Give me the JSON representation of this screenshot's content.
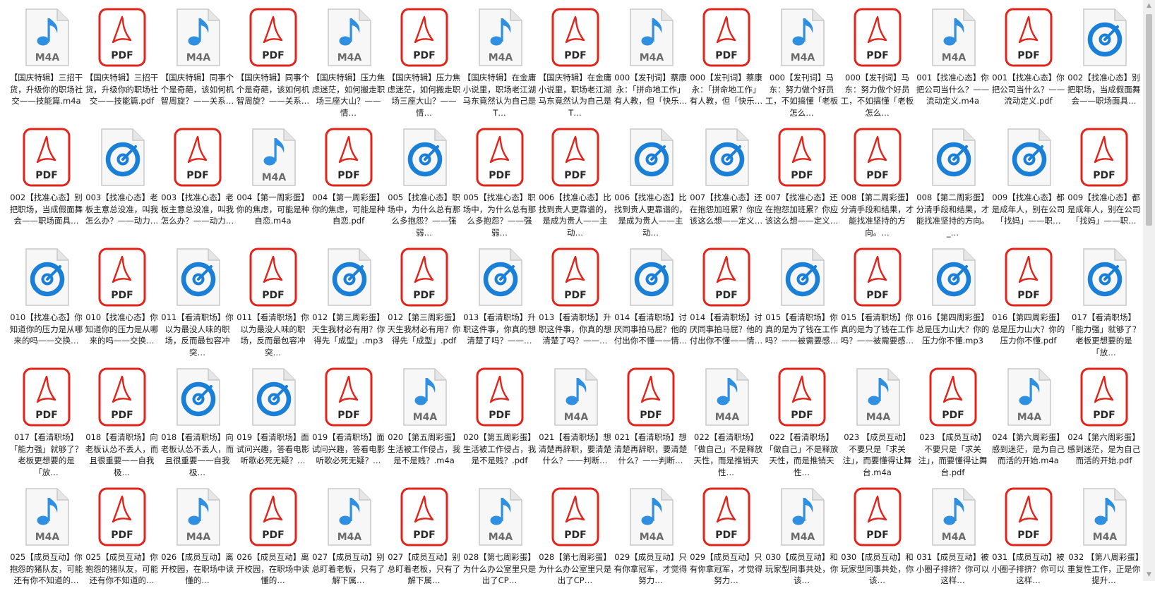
{
  "icon_names": {
    "pdf": "pdf-icon",
    "m4a": "m4a-audio-icon",
    "mp3": "mp3-audio-icon"
  },
  "icon_text": {
    "pdf": "PDF",
    "m4a": "M4A"
  },
  "files": [
    {
      "type": "m4a",
      "name": "【国庆特辑】三招干货，升级你的职场社交——技能篇.m4a"
    },
    {
      "type": "pdf",
      "name": "【国庆特辑】三招干货，升级你的职场社交——技能篇.pdf"
    },
    {
      "type": "m4a",
      "name": "【国庆特辑】同事个个是奇葩，该如何机智周旋？——关系…"
    },
    {
      "type": "pdf",
      "name": "【国庆特辑】同事个个是奇葩，该如何机智周旋？——关系…"
    },
    {
      "type": "m4a",
      "name": "【国庆特辑】压力焦虑迷茫，如何搬走职场三座大山？——情…"
    },
    {
      "type": "pdf",
      "name": "【国庆特辑】压力焦虑迷茫，如何搬走职场三座大山？——情…"
    },
    {
      "type": "m4a",
      "name": "【国庆特辑】在金庸小说里，职场老江湖马东竟然认为自己是T…"
    },
    {
      "type": "pdf",
      "name": "【国庆特辑】在金庸小说里，职场老江湖马东竟然认为自己是T…"
    },
    {
      "type": "m4a",
      "name": "000【发刊词】蔡康永：「拼命地工作」有人教，但「快乐…"
    },
    {
      "type": "pdf",
      "name": "000【发刊词】蔡康永：「拼命地工作」有人教，但「快乐…"
    },
    {
      "type": "m4a",
      "name": "000【发刊词】马东：努力做个好员工，不如搞懂「老板怎么…"
    },
    {
      "type": "pdf",
      "name": "000【发刊词】马东：努力做个好员工，不如搞懂「老板怎么…"
    },
    {
      "type": "m4a",
      "name": "001【找准心态】你把公司当什么？——流动定义.m4a"
    },
    {
      "type": "pdf",
      "name": "001【找准心态】你把公司当什么？——流动定义.pdf"
    },
    {
      "type": "mp3",
      "name": "002【找准心态】别把职场，当成假面舞会——职场面具…"
    },
    {
      "type": "pdf",
      "name": "002【找准心态】别把职场，当成假面舞会——职场面具…"
    },
    {
      "type": "mp3",
      "name": "003【找准心态】老板主意总没准，叫我怎么办？——动力…"
    },
    {
      "type": "pdf",
      "name": "003【找准心态】老板主意总没准，叫我怎么办？——动力…"
    },
    {
      "type": "m4a",
      "name": "004【第一周彩蛋】你的焦虑，可能是种自恋.m4a"
    },
    {
      "type": "pdf",
      "name": "004【第一周彩蛋】你的焦虑，可能是种自恋.pdf"
    },
    {
      "type": "mp3",
      "name": "005【找准心态】职场中，为什么总有那么多抱怨？——强弱…"
    },
    {
      "type": "pdf",
      "name": "005【找准心态】职场中，为什么总有那么多抱怨？——强弱…"
    },
    {
      "type": "pdf",
      "name": "006【找准心态】比找到贵人更靠谱的，是成为贵人——主动…"
    },
    {
      "type": "mp3",
      "name": "006【找准心态】比找到贵人更靠谱的，是成为贵人——主动…"
    },
    {
      "type": "mp3",
      "name": "007【找准心态】还在抱怨加班累？你应该这么想——定义…"
    },
    {
      "type": "pdf",
      "name": "007【找准心态】还在抱怨加班累？你应该这么想——定义…"
    },
    {
      "type": "pdf",
      "name": "008【第二周彩蛋】分清手段和结果，才能找准坚持的方向。…"
    },
    {
      "type": "mp3",
      "name": "008【第二周彩蛋】分清手段和结果，才能找准坚持的方向。_…"
    },
    {
      "type": "mp3",
      "name": "009【找准心态】都是成年人，别在公司「找妈」——职…"
    },
    {
      "type": "pdf",
      "name": "009【找准心态】都是成年人，别在公司「找妈」——职…"
    },
    {
      "type": "mp3",
      "name": "010【找准心态】你知道你的压力是从哪来的吗——交换…"
    },
    {
      "type": "pdf",
      "name": "010【找准心态】你知道你的压力是从哪来的吗——交换…"
    },
    {
      "type": "mp3",
      "name": "011【看清职场】你以为最没人味的职场，反而最包容冲突…"
    },
    {
      "type": "pdf",
      "name": "011【看清职场】你以为最没人味的职场，反而最包容冲突…"
    },
    {
      "type": "mp3",
      "name": "012【第三周彩蛋】天生我材必有用？你得先「成型」.mp3"
    },
    {
      "type": "pdf",
      "name": "012【第三周彩蛋】天生我材必有用？你得先「成型」.pdf"
    },
    {
      "type": "mp3",
      "name": "013【看清职场】升职这件事，你真的想清楚了吗？——…"
    },
    {
      "type": "pdf",
      "name": "013【看清职场】升职这件事，你真的想清楚了吗？——…"
    },
    {
      "type": "mp3",
      "name": "014【看清职场】讨厌同事拍马屁？他的付出你不懂——情…"
    },
    {
      "type": "pdf",
      "name": "014【看清职场】讨厌同事拍马屁？他的付出你不懂——情…"
    },
    {
      "type": "mp3",
      "name": "015【看清职场】你真的是为了钱在工作吗？——被需要感…"
    },
    {
      "type": "pdf",
      "name": "015【看清职场】你真的是为了钱在工作吗？——被需要感…"
    },
    {
      "type": "mp3",
      "name": "016【第四周彩蛋】总是压力山大？你的压力你不懂.mp3"
    },
    {
      "type": "pdf",
      "name": "016【第四周彩蛋】总是压力山大？你的压力你不懂.pdf"
    },
    {
      "type": "mp3",
      "name": "017【看清职场】「能力强」就够了？老板更想要的是「放…"
    },
    {
      "type": "pdf",
      "name": "017【看清职场】「能力强」就够了？老板更想要的是「放…"
    },
    {
      "type": "pdf",
      "name": "018【看清职场】向老板认怂不丢人，而且很重要——自我极…"
    },
    {
      "type": "mp3",
      "name": "018【看清职场】向老板认怂不丢人，而且很重要——自我极…"
    },
    {
      "type": "mp3",
      "name": "019【看清职场】面试问兴趣，答看电影听歌必死无疑？…"
    },
    {
      "type": "pdf",
      "name": "019【看清职场】面试问兴趣，答看电影听歌必死无疑？…"
    },
    {
      "type": "m4a",
      "name": "020【第五周彩蛋】生活被工作侵占，我是不是贱？.m4a"
    },
    {
      "type": "pdf",
      "name": "020【第五周彩蛋】生活被工作侵占，我是不是贱？.pdf"
    },
    {
      "type": "m4a",
      "name": "021【看清职场】想清楚再辞职，要清楚什么？——判断…"
    },
    {
      "type": "pdf",
      "name": "021【看清职场】想清楚再辞职，要清楚什么？——判断…"
    },
    {
      "type": "m4a",
      "name": "022【看清职场】「做自己」不是释放天性，而是推销天性…"
    },
    {
      "type": "pdf",
      "name": "022【看清职场】「做自己」不是释放天性，而是推销天性…"
    },
    {
      "type": "m4a",
      "name": "023 【成员互动】不要只是「求关注」，而要懂得让舞台.m4a"
    },
    {
      "type": "pdf",
      "name": "023 【成员互动】不要只是「求关注」，而要懂得让舞台.pdf"
    },
    {
      "type": "m4a",
      "name": "024【第六周彩蛋】感到迷茫，是为自己而活的开始.m4a"
    },
    {
      "type": "pdf",
      "name": "024【第六周彩蛋】感到迷茫，是为自己而活的开始.pdf"
    },
    {
      "type": "m4a",
      "name": "025【成员互动】你抱怨的猪队友，可能还有你不知道的…"
    },
    {
      "type": "pdf",
      "name": "025【成员互动】你抱怨的猪队友，可能还有你不知道的…"
    },
    {
      "type": "m4a",
      "name": "026【成员互动】离开校园，在职场中读懂的…"
    },
    {
      "type": "pdf",
      "name": "026【成员互动】离开校园，在职场中读懂的…"
    },
    {
      "type": "m4a",
      "name": "027【成员互动】别总盯着老板，只有了解下属…"
    },
    {
      "type": "pdf",
      "name": "027【成员互动】别总盯着老板，只有了解下属…"
    },
    {
      "type": "m4a",
      "name": "028【第七周彩蛋】为什么办公室里只是出了CP…"
    },
    {
      "type": "pdf",
      "name": "028【第七周彩蛋】为什么办公室里只是出了CP…"
    },
    {
      "type": "m4a",
      "name": "029【成员互动】只有你拿冠军，才觉得努力…"
    },
    {
      "type": "pdf",
      "name": "029【成员互动】只有你拿冠军，才觉得努力…"
    },
    {
      "type": "m4a",
      "name": "030【成员互动】和玩家型同事共处，你该…"
    },
    {
      "type": "pdf",
      "name": "030【成员互动】和玩家型同事共处，你该…"
    },
    {
      "type": "m4a",
      "name": "031【成员互动】被小圈子排挤？你可以这样…"
    },
    {
      "type": "pdf",
      "name": "031【成员互动】被小圈子排挤？你可以这样…"
    },
    {
      "type": "m4a",
      "name": "032 【第八周彩蛋】重复性工作，正是你提升…"
    }
  ],
  "scrollbar": {
    "up": "▲",
    "down": "▼"
  }
}
